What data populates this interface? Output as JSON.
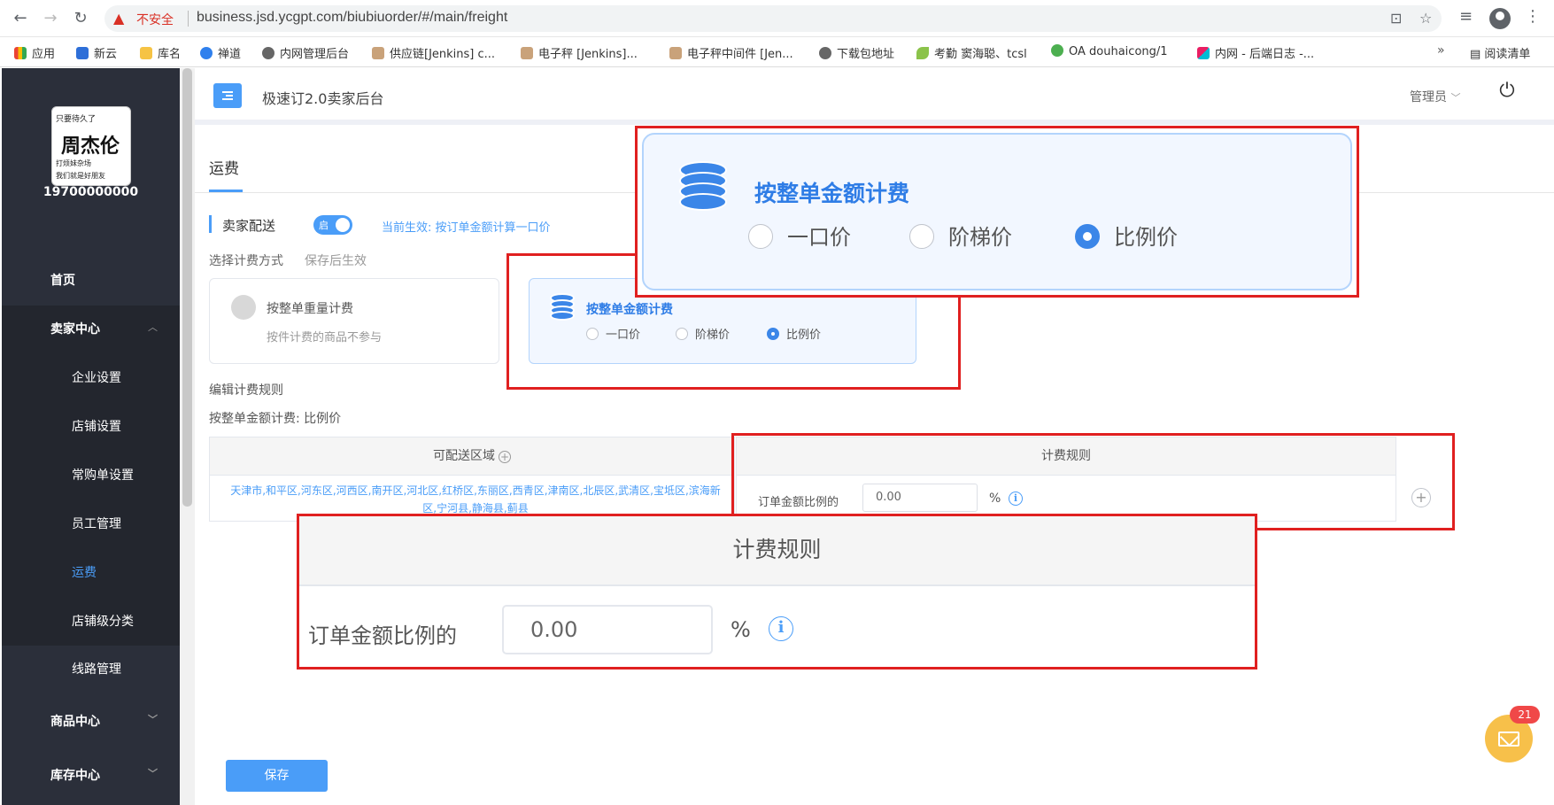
{
  "browser": {
    "security_label": "不安全",
    "url": "business.jsd.ycgpt.com/biubiuorder/#/main/freight",
    "bookmarks": [
      "应用",
      "新云",
      "库名",
      "禅道",
      "内网管理后台",
      "供应链[Jenkins]  c...",
      "电子秤  [Jenkins]...",
      "电子秤中间件 [Jen...",
      "下载包地址",
      "考勤  窦海聪、tcsl",
      "OA   douhaicong/1",
      "内网 - 后端日志 -..."
    ],
    "more": "»",
    "reading_list": "阅读清单"
  },
  "sidebar": {
    "logo": {
      "line1": "只要待久了",
      "line2": "周杰伦",
      "line3": "打烦妹杂场",
      "line4": "我们就是好朋友"
    },
    "user": "19700000000",
    "home": "首页",
    "seller_center": "卖家中心",
    "sub_items": [
      "企业设置",
      "店铺设置",
      "常购单设置",
      "员工管理",
      "运费",
      "店铺级分类",
      "线路管理"
    ],
    "product_center": "商品中心",
    "inventory_center": "库存中心"
  },
  "header": {
    "title": "极速订2.0卖家后台",
    "admin": "管理员"
  },
  "content": {
    "tab": "运费",
    "seller_delivery_label": "卖家配送",
    "toggle_text": "启",
    "effective_text": "当前生效: 按订单金额计算一口价",
    "mode_label": "选择计费方式",
    "mode_hint": "保存后生效",
    "weight_card": {
      "title": "按整单重量计费",
      "desc": "按件计费的商品不参与"
    },
    "amount_card": {
      "title": "按整单金额计费",
      "options": [
        "一口价",
        "阶梯价",
        "比例价"
      ],
      "selected": "比例价"
    },
    "rules_title": "编辑计费规则",
    "rules_sub": "按整单金额计费: 比例价",
    "area_table": {
      "header": "可配送区域",
      "value": "天津市,和平区,河东区,河西区,南开区,河北区,红桥区,东丽区,西青区,津南区,北辰区,武清区,宝坻区,滨海新区,宁河县,静海县,蓟县"
    },
    "rule_table": {
      "header": "计费规则",
      "label": "订单金额比例的",
      "value": "0.00",
      "unit": "%"
    },
    "save": "保存"
  },
  "chat": {
    "badge": "21"
  },
  "zoom": {
    "amount_title": "按整单金额计费",
    "options": [
      "一口价",
      "阶梯价",
      "比例价"
    ],
    "rule_header": "计费规则",
    "rule_label": "订单金额比例的",
    "rule_value": "0.00",
    "rule_unit": "%"
  },
  "colors": {
    "accent": "#4a9df8",
    "sidebar": "#2b2f3a",
    "annotation": "#e02020"
  }
}
